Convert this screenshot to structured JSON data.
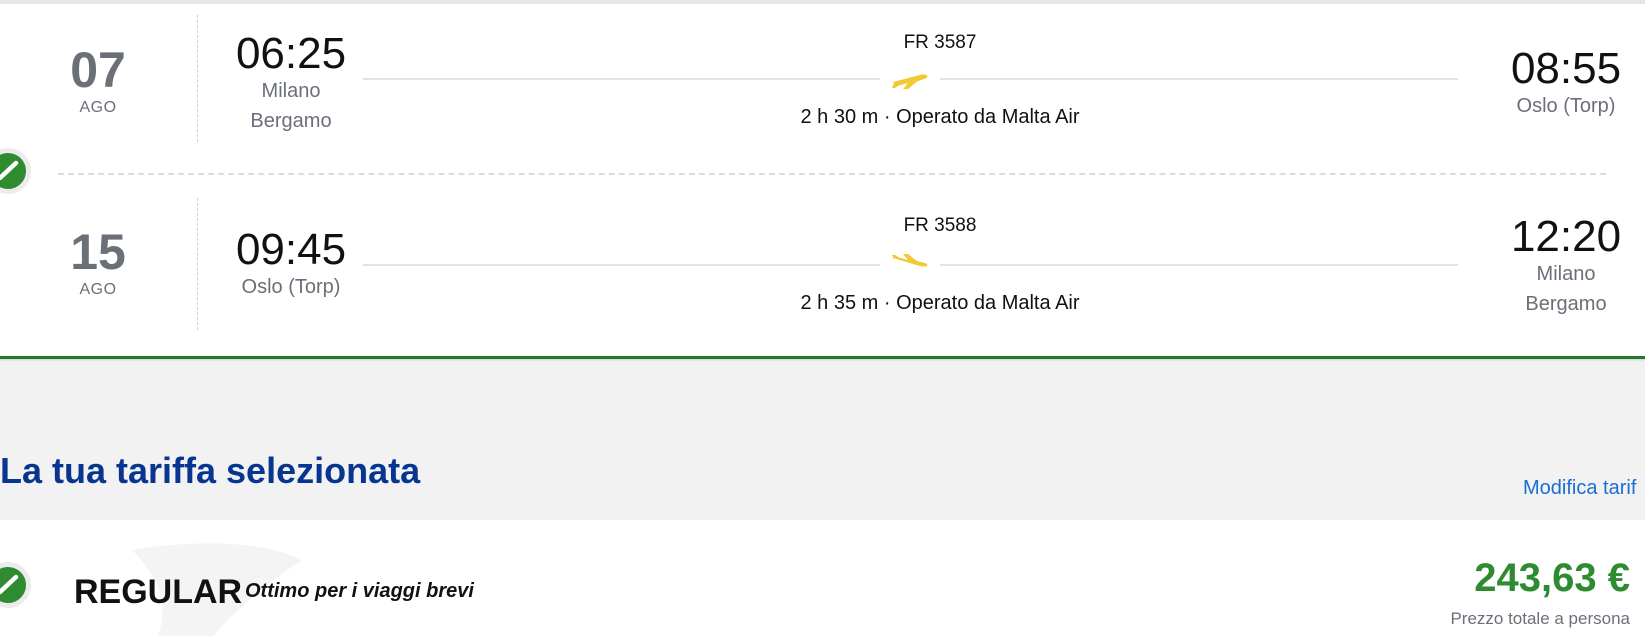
{
  "flights": [
    {
      "date_day": "07",
      "date_month": "AGO",
      "dep_time": "06:25",
      "dep_city_line1": "Milano",
      "dep_city_line2": "Bergamo",
      "flight_number": "FR 3587",
      "duration_operator": "2 h 30 m · Operato da Malta Air",
      "arr_time": "08:55",
      "arr_city_line1": "Oslo (Torp)",
      "arr_city_line2": ""
    },
    {
      "date_day": "15",
      "date_month": "AGO",
      "dep_time": "09:45",
      "dep_city_line1": "Oslo (Torp)",
      "dep_city_line2": "",
      "flight_number": "FR 3588",
      "duration_operator": "2 h 35 m · Operato da Malta Air",
      "arr_time": "12:20",
      "arr_city_line1": "Milano",
      "arr_city_line2": "Bergamo"
    }
  ],
  "fare_section": {
    "title": "La tua tariffa selezionata",
    "modify_link": "Modifica tarif"
  },
  "fare": {
    "name": "REGULAR",
    "tagline": "Ottimo per i viaggi brevi",
    "price": "243,63 €",
    "price_note": "Prezzo totale a persona"
  },
  "colors": {
    "accent_green": "#2e8b30",
    "title_blue": "#073590",
    "link_blue": "#1a6fd0",
    "plane_yellow": "#f1c933",
    "muted_gray": "#6b6f78"
  },
  "icons": {
    "selected": "check-circle-icon",
    "outbound": "plane-takeoff-icon",
    "inbound": "plane-landing-icon",
    "watermark": "harp-logo-icon"
  }
}
